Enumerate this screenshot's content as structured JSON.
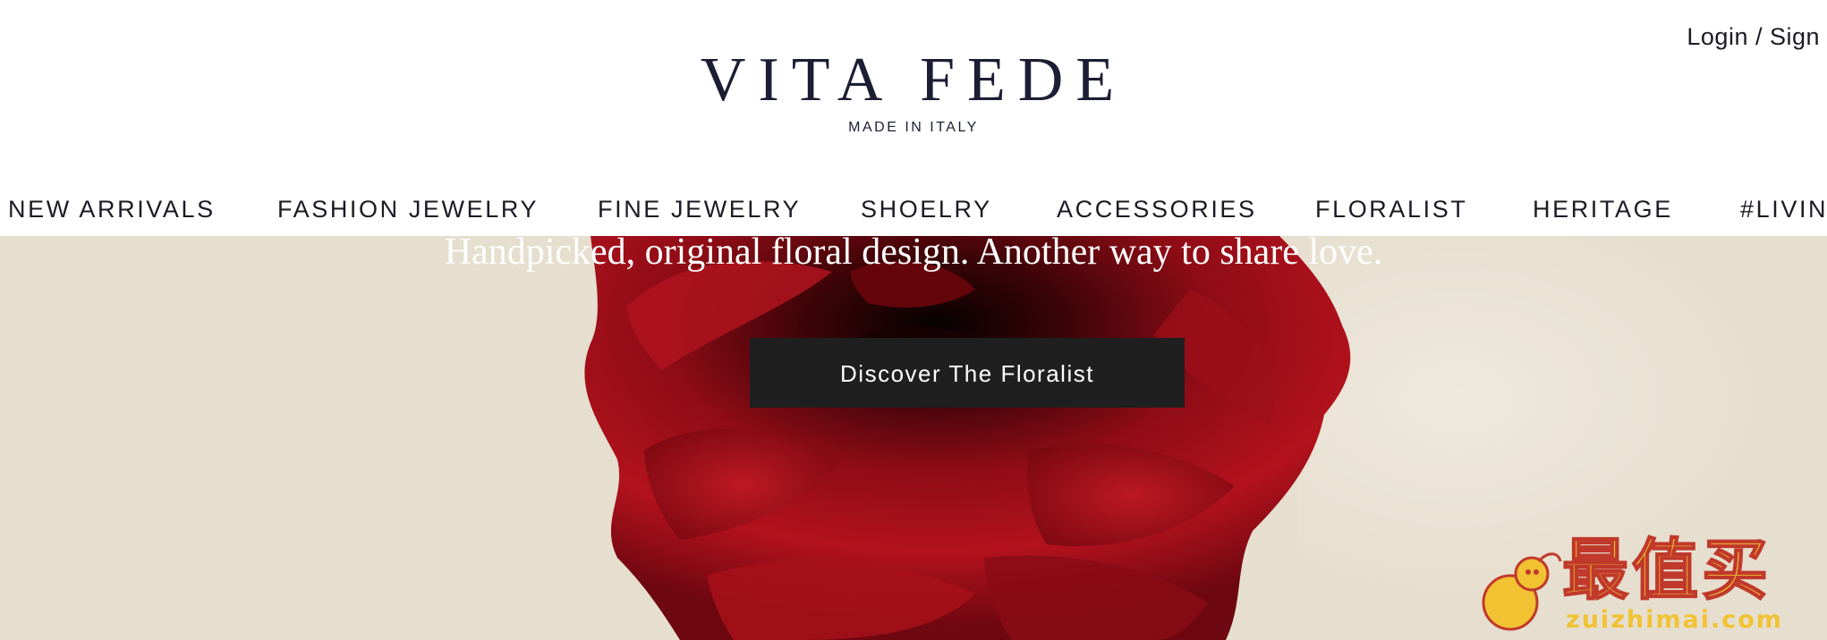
{
  "header": {
    "login_label": "Login / Sign",
    "logo_title": "VITA FEDE",
    "logo_subtitle": "MADE IN ITALY"
  },
  "nav": {
    "items": [
      {
        "label": "NEW ARRIVALS"
      },
      {
        "label": "FASHION JEWELRY"
      },
      {
        "label": "FINE JEWELRY"
      },
      {
        "label": "SHOELRY"
      },
      {
        "label": "ACCESSORIES"
      },
      {
        "label": "FLORALIST"
      },
      {
        "label": "HERITAGE"
      },
      {
        "label": "#LIVING"
      }
    ]
  },
  "hero": {
    "tagline": "Handpicked, original floral design. Another way to share love.",
    "cta_label": "Discover The Floralist"
  },
  "watermark": {
    "brand_cn": "最值买",
    "brand_url": "zuizhimai.com"
  },
  "colors": {
    "text_dark": "#1b1b24",
    "hero_background": "#e6dece",
    "cta_background": "#1f1f1f",
    "rose_red": "#a8101a"
  }
}
